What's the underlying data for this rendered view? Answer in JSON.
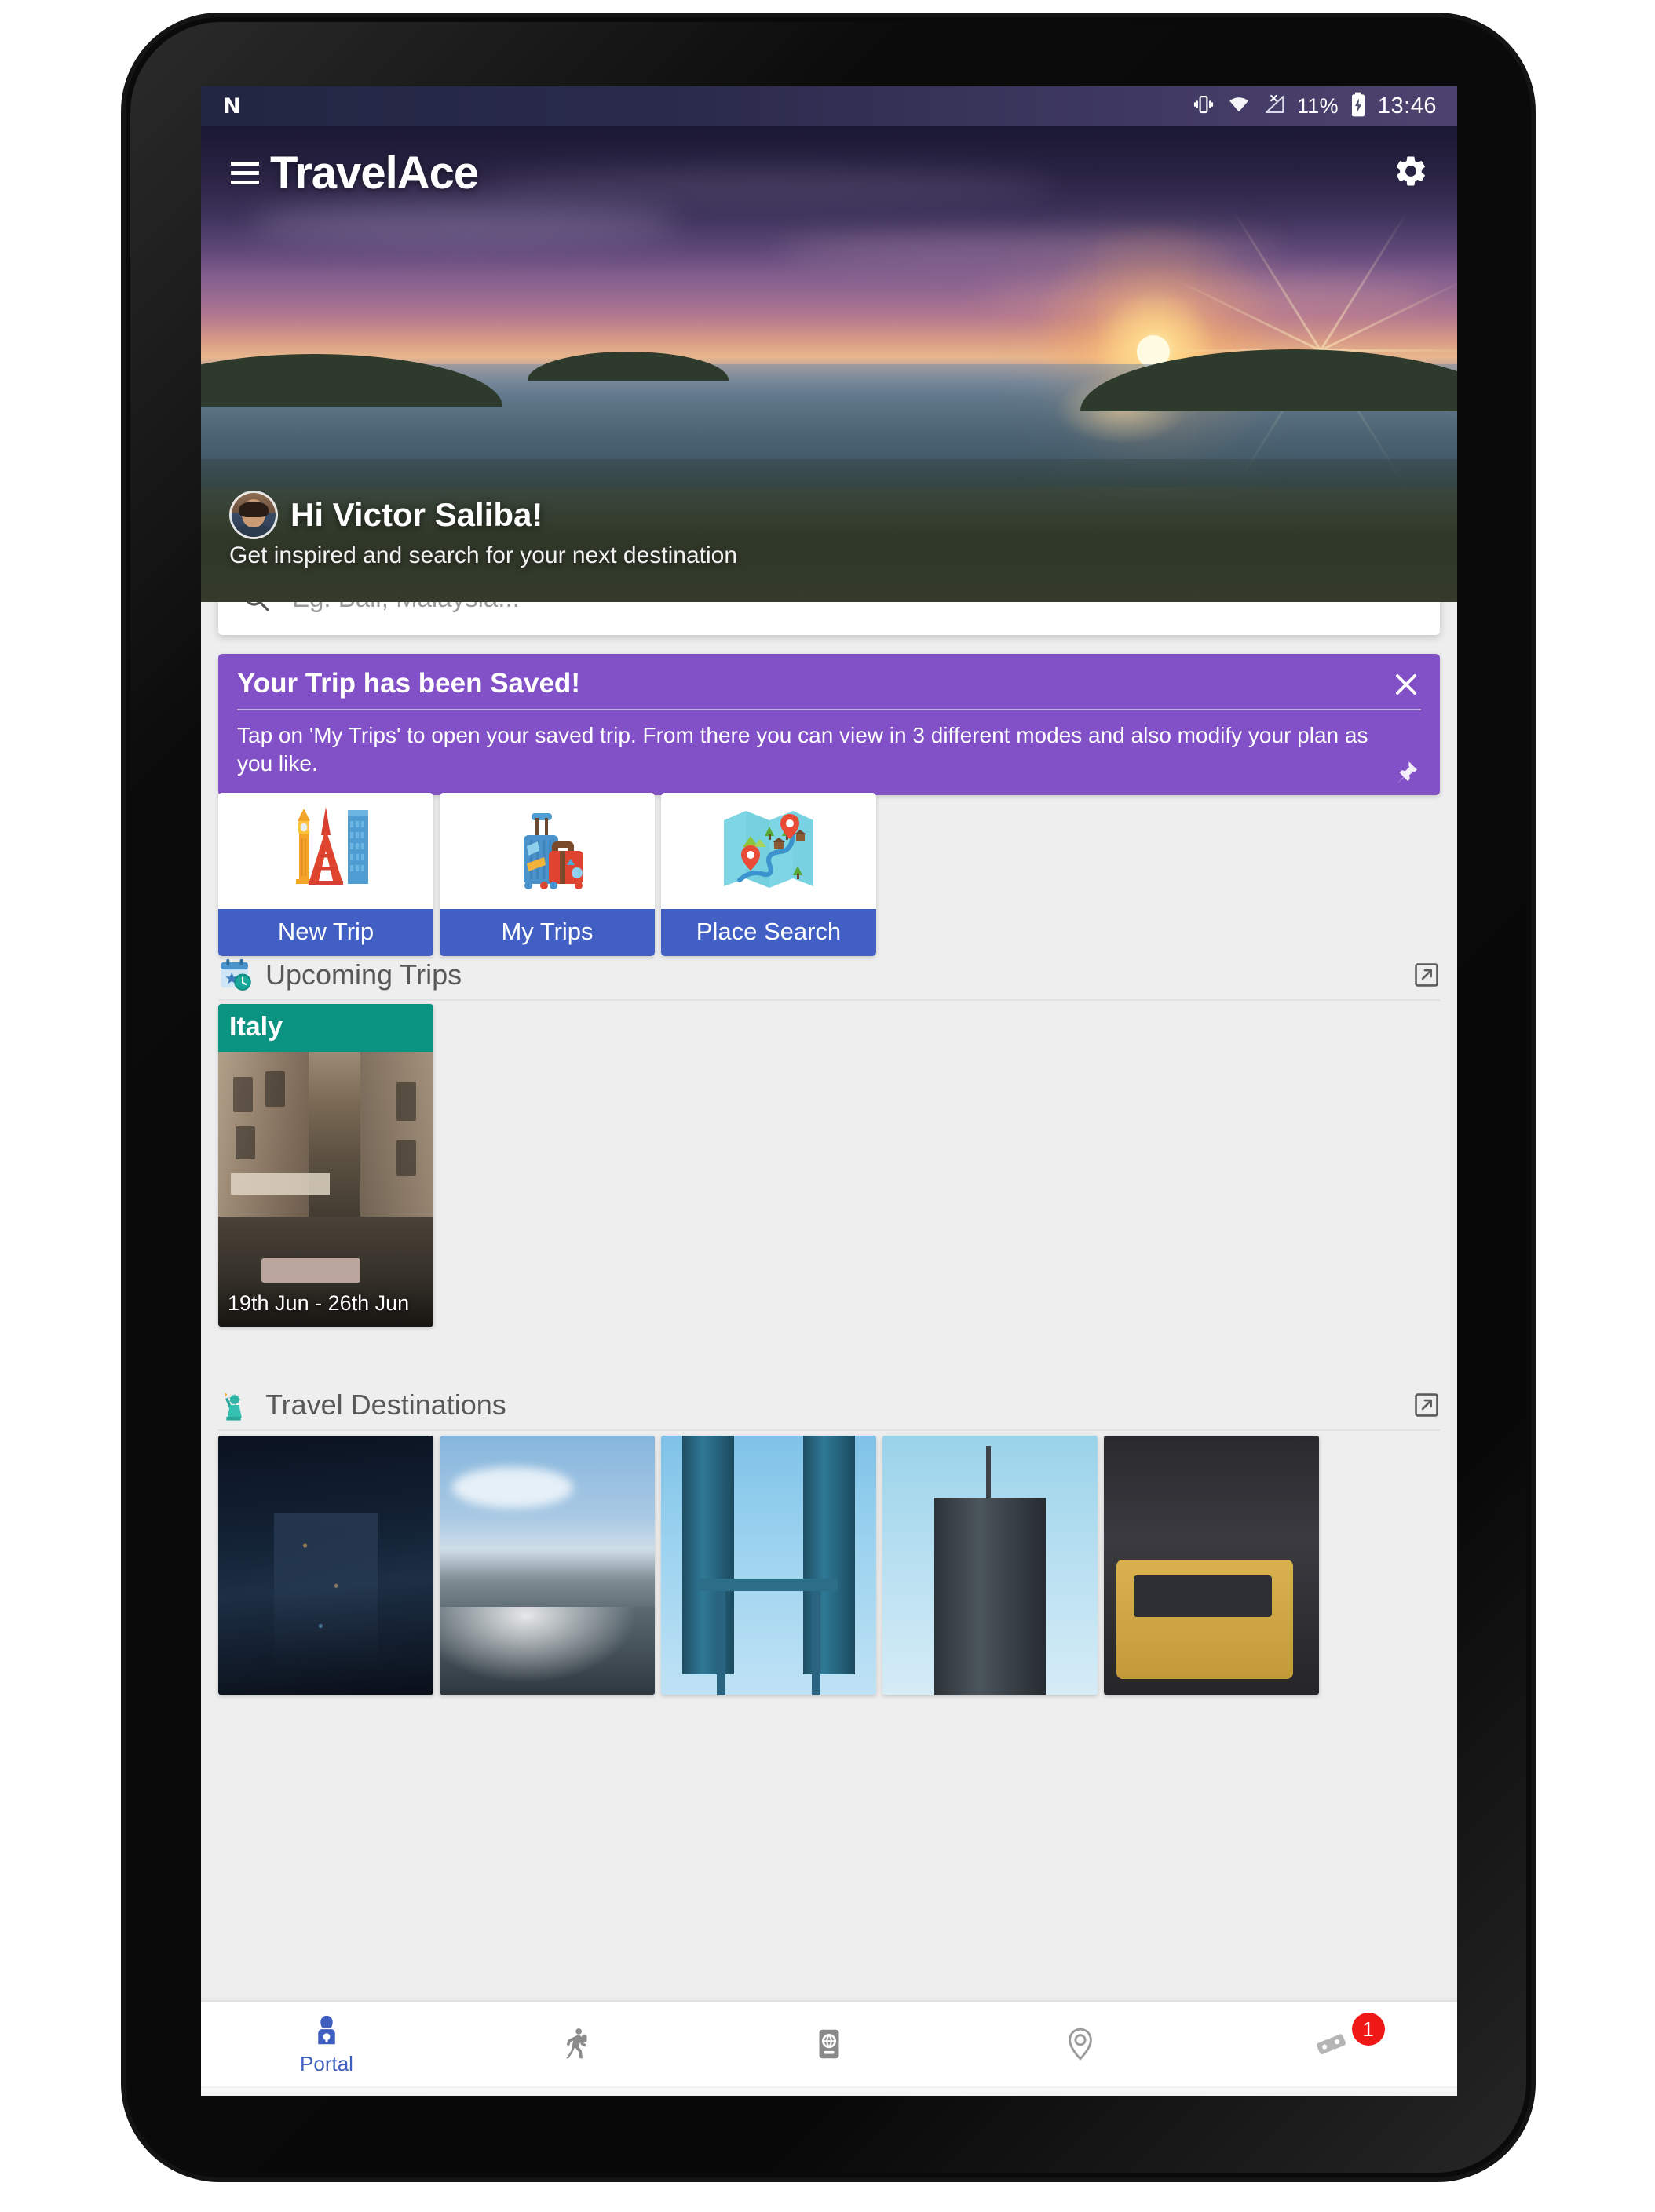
{
  "status_bar": {
    "notification_logo": "N",
    "icons": [
      "vibrate-icon",
      "wifi-icon",
      "no-signal-icon"
    ],
    "battery_percent": "11%",
    "battery_icon": "battery-charging-icon",
    "time": "13:46"
  },
  "app_bar": {
    "menu_icon": "hamburger-menu-icon",
    "title": "TravelAce",
    "settings_icon": "gear-icon"
  },
  "hero": {
    "avatar": "user-avatar",
    "greeting": "Hi Victor Saliba!",
    "subtitle": "Get inspired and search for your next destination"
  },
  "search": {
    "icon": "search-icon",
    "placeholder": "Eg. Bali, Malaysia...",
    "value": ""
  },
  "banner": {
    "title": "Your Trip has been Saved!",
    "message": "Tap on 'My Trips' to open your saved trip. From there you can view in 3 different modes and also modify your plan as you like.",
    "close_icon": "close-icon",
    "pin_icon": "pin-icon",
    "color": "#8251c7"
  },
  "actions": [
    {
      "label": "New Trip",
      "icon": "landmarks-icon"
    },
    {
      "label": "My Trips",
      "icon": "luggage-icon"
    },
    {
      "label": "Place Search",
      "icon": "map-icon"
    }
  ],
  "action_button_color": "#4260c4",
  "sections": [
    {
      "title": "Upcoming Trips",
      "icon": "calendar-clock-icon",
      "expand_icon": "expand-icon"
    },
    {
      "title": "Travel Destinations",
      "icon": "statue-of-liberty-icon",
      "expand_icon": "expand-icon"
    }
  ],
  "upcoming_trips": [
    {
      "destination": "Italy",
      "dates": "19th Jun - 26th Jun",
      "header_color": "#0a9380"
    }
  ],
  "travel_destinations": [
    {
      "name": "city-night-aerial"
    },
    {
      "name": "coastal-cliffs-sea"
    },
    {
      "name": "petronas-twin-towers"
    },
    {
      "name": "skyscraper-spire"
    },
    {
      "name": "yellow-taxi-street"
    }
  ],
  "bottom_nav": [
    {
      "label": "Portal",
      "icon": "portal-person-icon",
      "active": true,
      "badge": ""
    },
    {
      "label": "",
      "icon": "hiker-icon",
      "active": false,
      "badge": ""
    },
    {
      "label": "",
      "icon": "passport-icon",
      "active": false,
      "badge": ""
    },
    {
      "label": "",
      "icon": "location-pin-icon",
      "active": false,
      "badge": ""
    },
    {
      "label": "",
      "icon": "tickets-icon",
      "active": false,
      "badge": "1"
    }
  ],
  "system_nav": {
    "back_icon": "back-triangle-icon",
    "home_icon": "home-circle-icon",
    "recents_icon": "recents-square-icon"
  },
  "accent_colors": {
    "nav_active": "#3f5fc0",
    "badge": "#f01717",
    "banner": "#8251c7",
    "trip_header": "#0a9380"
  }
}
